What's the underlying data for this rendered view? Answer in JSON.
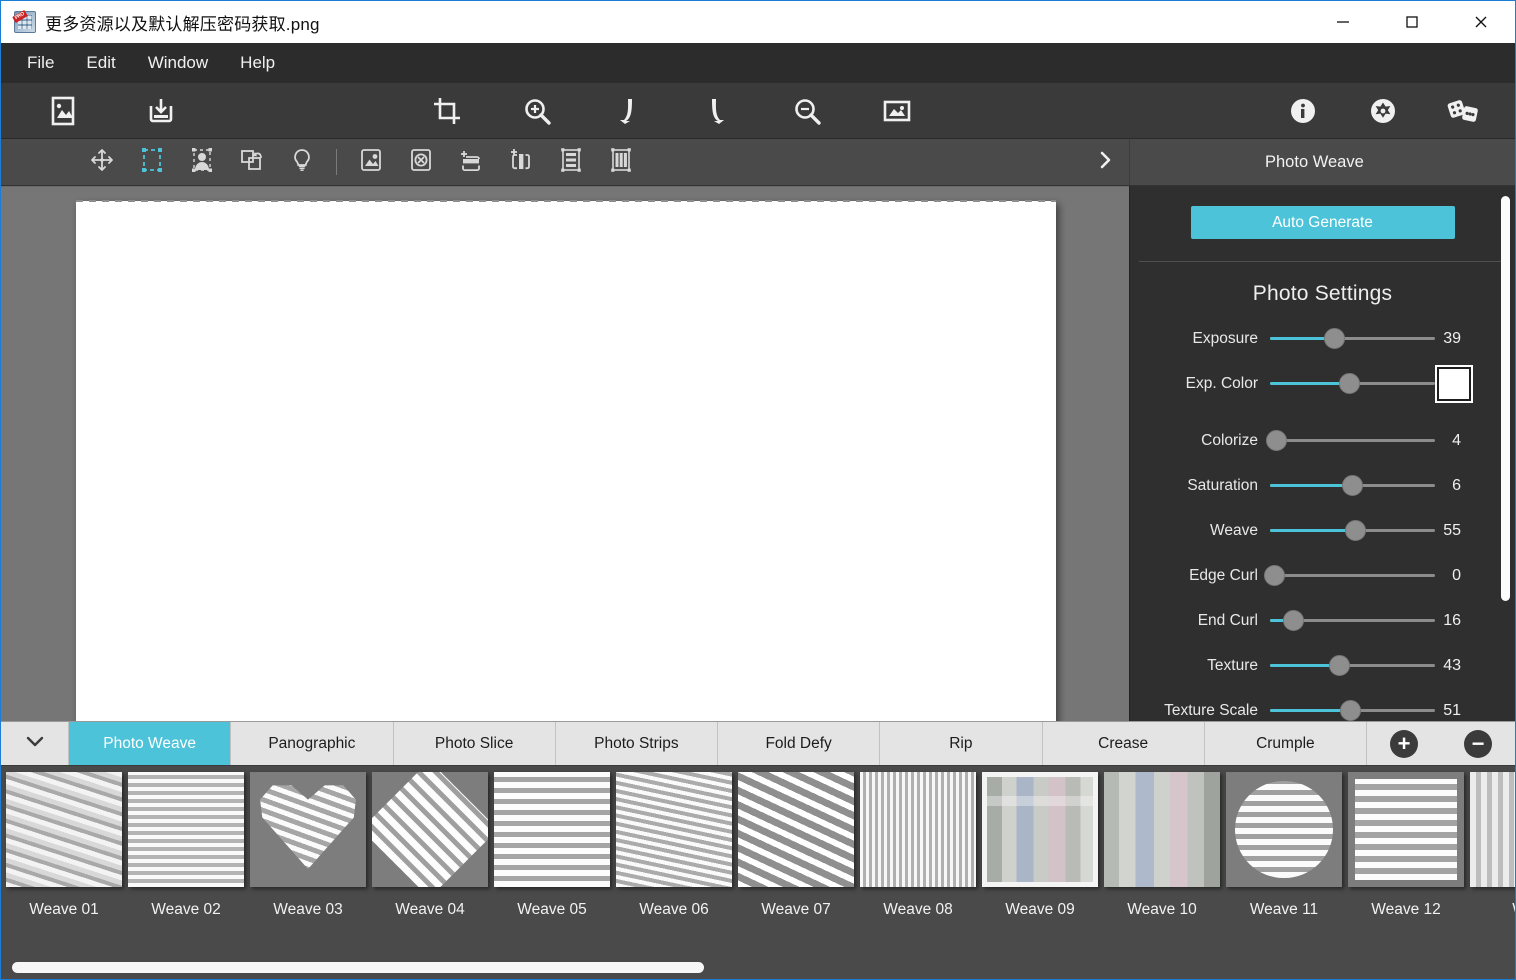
{
  "window": {
    "title": "更多资源以及默认解压密码获取.png",
    "app_icon": "photo-app-icon",
    "minimize_label": "−",
    "maximize_label": "□",
    "close_label": "×"
  },
  "menubar": {
    "items": [
      {
        "label": "File"
      },
      {
        "label": "Edit"
      },
      {
        "label": "Window"
      },
      {
        "label": "Help"
      }
    ]
  },
  "toolbar_main": {
    "left": [
      {
        "name": "open-image-icon"
      },
      {
        "name": "save-image-icon"
      }
    ],
    "center": [
      {
        "name": "crop-icon"
      },
      {
        "name": "zoom-in-icon"
      },
      {
        "name": "undo-icon"
      },
      {
        "name": "redo-icon"
      },
      {
        "name": "zoom-out-icon"
      },
      {
        "name": "fit-image-icon"
      }
    ],
    "right": [
      {
        "name": "info-icon"
      },
      {
        "name": "settings-icon"
      },
      {
        "name": "dice-icon"
      }
    ]
  },
  "toolbar_sub": {
    "tools": [
      {
        "name": "move-tool-icon",
        "active": false
      },
      {
        "name": "marquee-select-tool-icon",
        "active": true
      },
      {
        "name": "subject-select-tool-icon",
        "active": false
      },
      {
        "name": "transform-tool-icon",
        "active": false
      },
      {
        "name": "lightbulb-tool-icon",
        "active": false
      }
    ],
    "actions": [
      {
        "name": "add-image-icon"
      },
      {
        "name": "remove-image-icon"
      },
      {
        "name": "add-row-icon"
      },
      {
        "name": "add-column-icon"
      },
      {
        "name": "rows-layout-icon"
      },
      {
        "name": "columns-layout-icon"
      }
    ],
    "expand_label": "›",
    "panel_title": "Photo Weave"
  },
  "panel": {
    "auto_generate_label": "Auto Generate",
    "section_title": "Photo Settings",
    "accent_color": "#4cc3d9",
    "sliders": [
      {
        "label": "Exposure",
        "value": "39",
        "pct": 39,
        "type": "number"
      },
      {
        "label": "Exp. Color",
        "value": "48",
        "pct": 48,
        "type": "swatch",
        "swatch_color": "#ffffff"
      },
      {
        "label": "Colorize",
        "value": "4",
        "pct": 4,
        "type": "number"
      },
      {
        "label": "Saturation",
        "value": "6",
        "pct": 50,
        "type": "number"
      },
      {
        "label": "Weave",
        "value": "55",
        "pct": 55,
        "type": "number"
      },
      {
        "label": "Edge Curl",
        "value": "0",
        "pct": 0,
        "type": "number"
      },
      {
        "label": "End Curl",
        "value": "16",
        "pct": 16,
        "type": "number"
      },
      {
        "label": "Texture",
        "value": "43",
        "pct": 43,
        "type": "number"
      },
      {
        "label": "Texture Scale",
        "value": "51",
        "pct": 51,
        "type": "number"
      }
    ],
    "scrollbar": {
      "thumb_top_pct": 2,
      "thumb_height_pct": 72
    }
  },
  "tabs": {
    "collapse_icon": "chevron-down-icon",
    "items": [
      {
        "label": "Photo Weave",
        "active": true
      },
      {
        "label": "Panographic",
        "active": false
      },
      {
        "label": "Photo Slice",
        "active": false
      },
      {
        "label": "Photo Strips",
        "active": false
      },
      {
        "label": "Fold Defy",
        "active": false
      },
      {
        "label": "Rip",
        "active": false
      },
      {
        "label": "Crease",
        "active": false
      },
      {
        "label": "Crumple",
        "active": false
      }
    ],
    "add_label": "+",
    "remove_label": "−"
  },
  "presets": {
    "items": [
      {
        "label": "Weave 01",
        "tex": "w1",
        "selected": false
      },
      {
        "label": "Weave 02",
        "tex": "w2",
        "selected": false
      },
      {
        "label": "Weave 03",
        "tex": "w3",
        "selected": false
      },
      {
        "label": "Weave 04",
        "tex": "w4",
        "selected": false
      },
      {
        "label": "Weave 05",
        "tex": "w5",
        "selected": false
      },
      {
        "label": "Weave 06",
        "tex": "w6",
        "selected": false
      },
      {
        "label": "Weave 07",
        "tex": "w7",
        "selected": false
      },
      {
        "label": "Weave 08",
        "tex": "w8",
        "selected": false
      },
      {
        "label": "Weave 09",
        "tex": "w9",
        "selected": true
      },
      {
        "label": "Weave 10",
        "tex": "w10",
        "selected": false
      },
      {
        "label": "Weave 11",
        "tex": "w11",
        "selected": false
      },
      {
        "label": "Weave 12",
        "tex": "w12",
        "selected": false
      },
      {
        "label": "Wea",
        "tex": "w13",
        "selected": false
      }
    ]
  },
  "canvas": {
    "document_background": "#ffffff",
    "workspace_background": "#767676"
  }
}
